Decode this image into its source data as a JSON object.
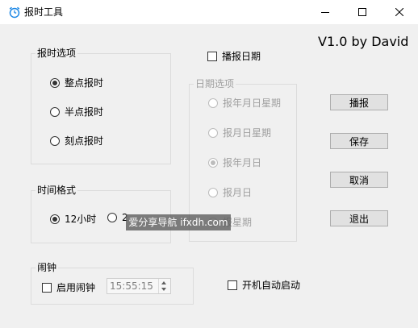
{
  "window": {
    "title": "报时工具",
    "version": "V1.0 by David",
    "controls": {
      "minimize": "minimize",
      "maximize": "maximize",
      "close": "close"
    }
  },
  "report_options": {
    "label": "报时选项",
    "items": [
      {
        "label": "整点报时",
        "checked": true
      },
      {
        "label": "半点报时",
        "checked": false
      },
      {
        "label": "刻点报时",
        "checked": false
      }
    ]
  },
  "time_format": {
    "label": "时间格式",
    "items": [
      {
        "label": "12小时",
        "checked": true
      },
      {
        "label": "2",
        "checked": false
      }
    ]
  },
  "alarm": {
    "label": "闹钟",
    "enable_label": "启用闹钟",
    "time_value": "15:55:15"
  },
  "announce_date": {
    "label": "播报日期",
    "checked": false
  },
  "date_options": {
    "label": "日期选项",
    "items": [
      {
        "label": "报年月日星期",
        "checked": false
      },
      {
        "label": "报月日星期",
        "checked": false
      },
      {
        "label": "报年月日",
        "checked": true
      },
      {
        "label": "报月日",
        "checked": false
      },
      {
        "label": "报星期",
        "checked": false
      }
    ]
  },
  "buttons": {
    "play": "播报",
    "save": "保存",
    "cancel": "取消",
    "exit": "退出"
  },
  "autostart": {
    "label": "开机自动启动",
    "checked": false
  },
  "watermark": "爱分享导航 ifxdh.com",
  "colors": {
    "icon_accent": "#1e88e5",
    "disabled_text": "#a0a0a0",
    "background": "#f0f0f0"
  }
}
